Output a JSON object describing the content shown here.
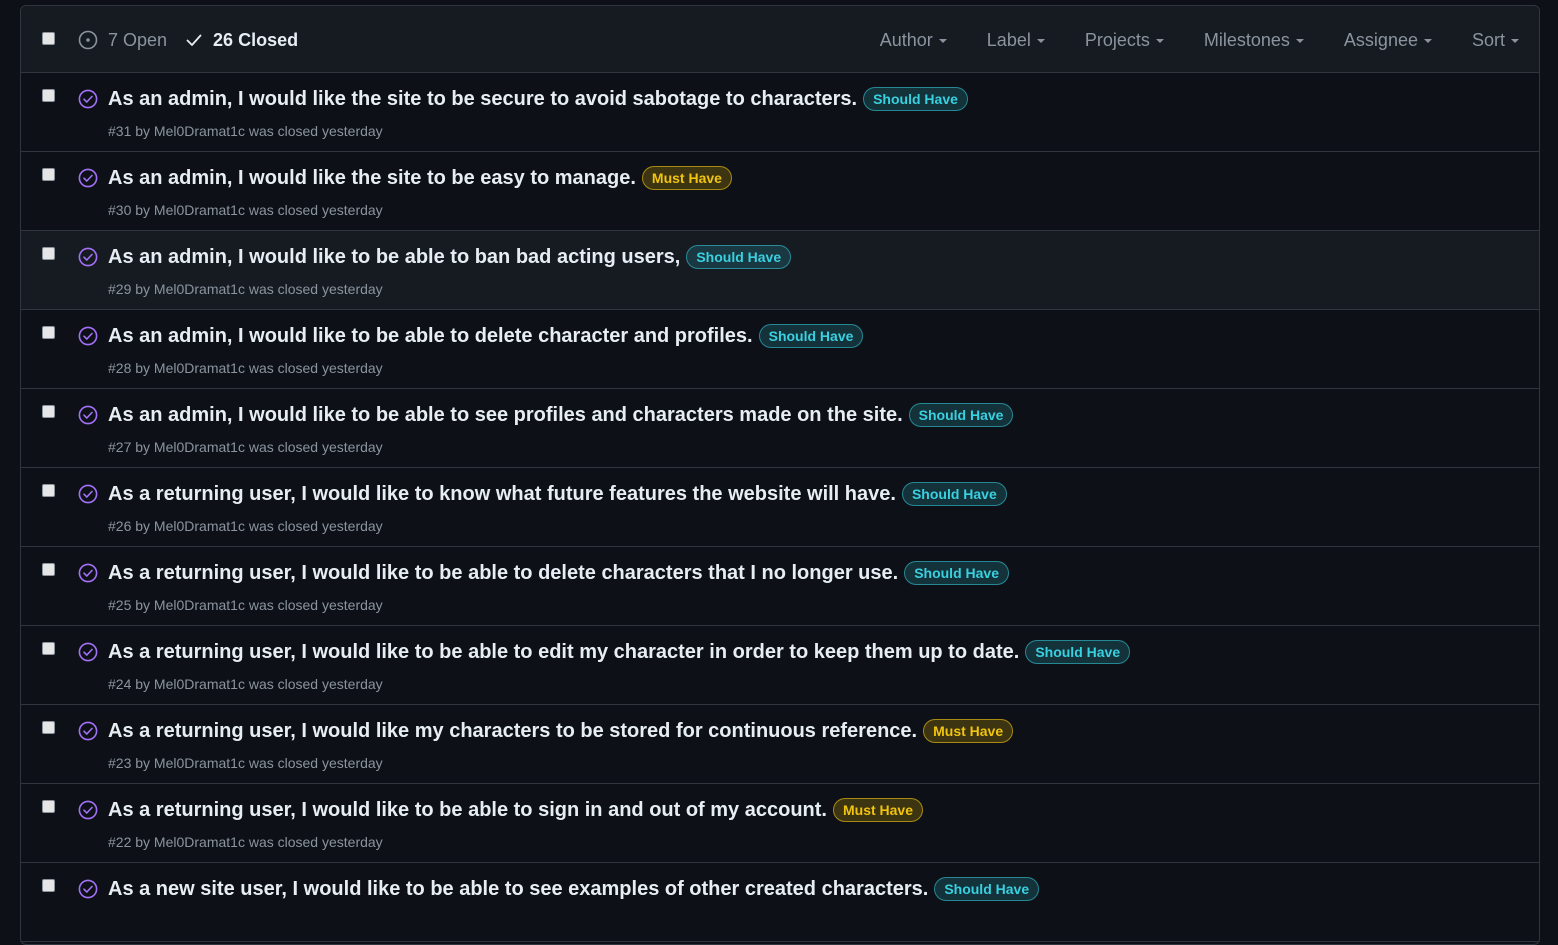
{
  "header": {
    "open_count_label": "7 Open",
    "closed_count_label": "26 Closed",
    "filters": [
      "Author",
      "Label",
      "Projects",
      "Milestones",
      "Assignee",
      "Sort"
    ]
  },
  "colors": {
    "closed_icon": "#a371f7",
    "should_have": "#39d0e0",
    "must_have": "#f1c40f"
  },
  "issues": [
    {
      "title": "As an admin, I would like the site to be secure to avoid sabotage to characters.",
      "label": "Should Have",
      "label_type": "should",
      "meta": "#31 by Mel0Dramat1c was closed yesterday",
      "highlight": false
    },
    {
      "title": "As an admin, I would like the site to be easy to manage.",
      "label": "Must Have",
      "label_type": "must",
      "meta": "#30 by Mel0Dramat1c was closed yesterday",
      "highlight": false
    },
    {
      "title": "As an admin, I would like to be able to ban bad acting users,",
      "label": "Should Have",
      "label_type": "should",
      "meta": "#29 by Mel0Dramat1c was closed yesterday",
      "highlight": true
    },
    {
      "title": "As an admin, I would like to be able to delete character and profiles.",
      "label": "Should Have",
      "label_type": "should",
      "meta": "#28 by Mel0Dramat1c was closed yesterday",
      "highlight": false
    },
    {
      "title": "As an admin, I would like to be able to see profiles and characters made on the site.",
      "label": "Should Have",
      "label_type": "should",
      "meta": "#27 by Mel0Dramat1c was closed yesterday",
      "highlight": false
    },
    {
      "title": "As a returning user, I would like to know what future features the website will have.",
      "label": "Should Have",
      "label_type": "should",
      "meta": "#26 by Mel0Dramat1c was closed yesterday",
      "highlight": false
    },
    {
      "title": "As a returning user, I would like to be able to delete characters that I no longer use.",
      "label": "Should Have",
      "label_type": "should",
      "meta": "#25 by Mel0Dramat1c was closed yesterday",
      "highlight": false
    },
    {
      "title": "As a returning user, I would like to be able to edit my character in order to keep them up to date.",
      "label": "Should Have",
      "label_type": "should",
      "meta": "#24 by Mel0Dramat1c was closed yesterday",
      "highlight": false
    },
    {
      "title": "As a returning user, I would like my characters to be stored for continuous reference.",
      "label": "Must Have",
      "label_type": "must",
      "meta": "#23 by Mel0Dramat1c was closed yesterday",
      "highlight": false
    },
    {
      "title": "As a returning user, I would like to be able to sign in and out of my account.",
      "label": "Must Have",
      "label_type": "must",
      "meta": "#22 by Mel0Dramat1c was closed yesterday",
      "highlight": false
    },
    {
      "title": "As a new site user, I would like to be able to see examples of other created characters.",
      "label": "Should Have",
      "label_type": "should",
      "meta": "",
      "highlight": false
    }
  ]
}
